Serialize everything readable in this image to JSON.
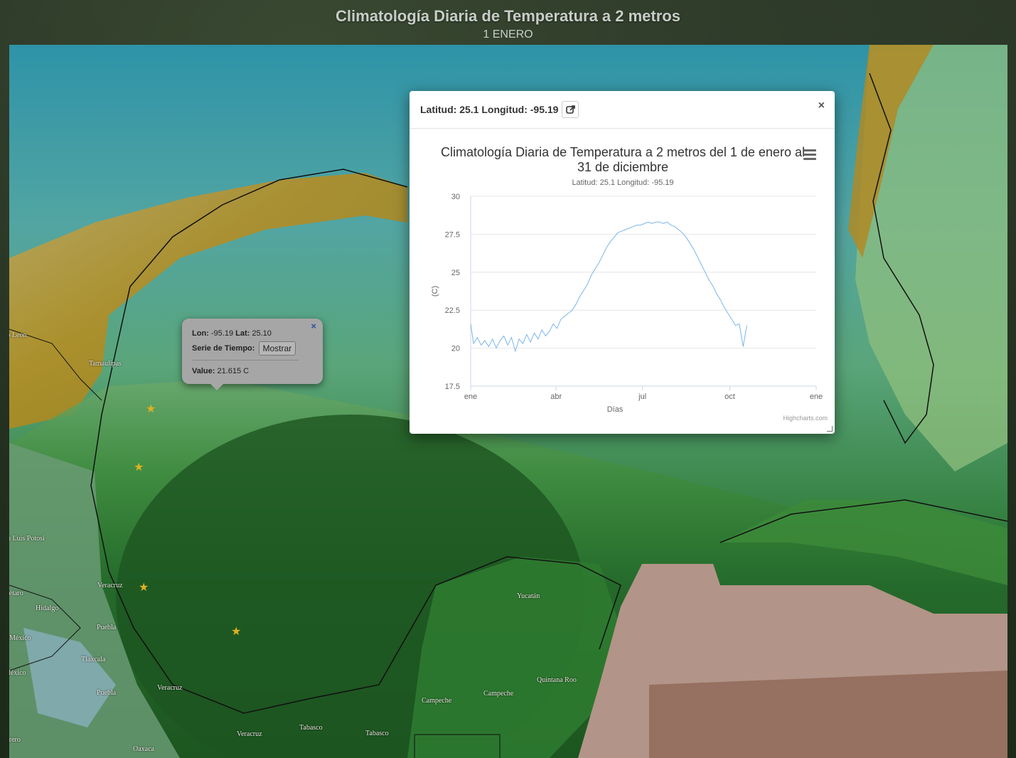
{
  "header": {
    "title": "Climatología Diaria de Temperatura a 2 metros",
    "subtitle": "1 ENERO"
  },
  "map_labels": [
    {
      "text": "evo León"
    },
    {
      "text": "Tamaulipas"
    },
    {
      "text": "San Luis Potosí"
    },
    {
      "text": "Veracruz"
    },
    {
      "text": "uerétaro"
    },
    {
      "text": "Hidalgo"
    },
    {
      "text": "Puebla"
    },
    {
      "text": "México"
    },
    {
      "text": "Tlaxcala"
    },
    {
      "text": "México"
    },
    {
      "text": "Puebla"
    },
    {
      "text": "Veracruz"
    },
    {
      "text": "uerrero"
    },
    {
      "text": "Oaxaca"
    },
    {
      "text": "Veracruz"
    },
    {
      "text": "Tabasco"
    },
    {
      "text": "Tabasco"
    },
    {
      "text": "Campeche"
    },
    {
      "text": "Campeche"
    },
    {
      "text": "Yucatán"
    },
    {
      "text": "Quintana Roo"
    }
  ],
  "popup": {
    "close_icon": "×",
    "lon_label": "Lon:",
    "lon_value": "-95.19",
    "lat_label": "Lat:",
    "lat_value": "25.10",
    "series_label": "Serie de Tiempo:",
    "show_button": "Mostrar",
    "value_label": "Value:",
    "value": "21.615 C"
  },
  "modal": {
    "header": "Latitud: 25.1 Longitud: -95.19",
    "close": "×",
    "external_link_icon": "external-link-icon",
    "credits": "Highcharts.com"
  },
  "chart_data": {
    "type": "line",
    "title": "Climatología Diaria de Temperatura a 2 metros del 1 de enero al 31 de diciembre",
    "subtitle": "Latitud: 25.1 Longitud: -95.19",
    "xlabel": "Días",
    "ylabel": "(C)",
    "ylim": [
      17.5,
      30
    ],
    "yticks": [
      "17.5",
      "20",
      "22.5",
      "25",
      "27.5",
      "30"
    ],
    "xticks": [
      "ene",
      "abr",
      "jul",
      "oct",
      "ene"
    ],
    "grid": true,
    "color": "#7cb5ec",
    "series": [
      {
        "x_days": [
          1,
          4,
          8,
          12,
          16,
          20,
          24,
          28,
          32,
          36,
          40,
          44,
          48,
          52,
          56,
          60,
          64,
          68,
          72,
          76,
          80,
          84,
          88,
          92,
          96,
          100,
          104,
          108,
          112,
          116,
          120,
          124,
          128,
          132,
          136,
          140,
          144,
          148,
          152,
          156,
          160,
          164,
          168,
          172,
          176,
          180,
          184,
          188,
          192,
          196,
          200,
          204,
          208,
          212,
          216,
          220,
          224,
          228,
          232,
          236,
          240,
          244,
          248,
          252,
          256,
          260,
          264,
          268,
          272,
          276,
          280,
          284,
          288,
          292,
          296,
          300,
          304,
          308,
          312,
          316,
          320,
          324,
          328,
          332,
          336,
          340,
          344,
          348,
          352,
          356,
          360,
          363,
          365
        ],
        "values": [
          21.6,
          20.3,
          20.7,
          20.2,
          20.5,
          20.1,
          20.6,
          20.0,
          20.5,
          20.8,
          20.2,
          20.7,
          19.8,
          20.6,
          20.3,
          20.9,
          20.4,
          21.0,
          20.6,
          21.2,
          20.8,
          21.1,
          21.6,
          21.3,
          21.9,
          22.1,
          22.3,
          22.5,
          22.9,
          23.4,
          23.8,
          24.2,
          24.8,
          25.2,
          25.6,
          26.1,
          26.6,
          27.0,
          27.3,
          27.6,
          27.7,
          27.8,
          27.9,
          28.0,
          28.1,
          28.1,
          28.2,
          28.3,
          28.2,
          28.3,
          28.3,
          28.2,
          28.3,
          28.1,
          28.0,
          27.8,
          27.6,
          27.3,
          26.9,
          26.5,
          26.0,
          25.5,
          25.0,
          24.5,
          24.1,
          23.6,
          23.2,
          22.7,
          22.3,
          21.9,
          21.5,
          21.6,
          20.1,
          21.5
        ]
      }
    ]
  }
}
